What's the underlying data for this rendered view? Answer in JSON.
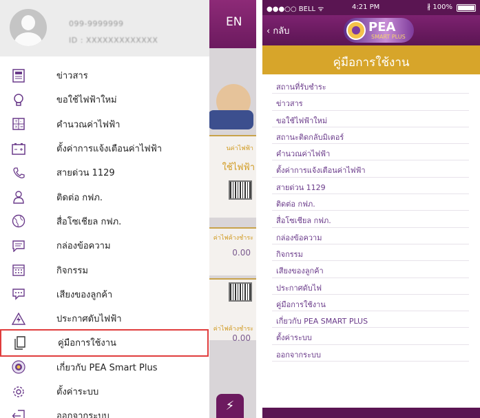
{
  "left": {
    "background_app": {
      "lang_button": "EN",
      "peek_small_1": "นค่าไฟฟ้า",
      "peek_big_1": "ใช้ไฟฟ้า",
      "peek_small_2": "ค่าไฟค้างชำระ",
      "value_1": "0.00",
      "peek_small_3": "ค่าไฟค้างชำระ",
      "value_2": "0.00",
      "bottom_button_icon": "⚡"
    },
    "profile": {
      "phone": "099-9999999",
      "id": "ID : XXXXXXXXXXXXX"
    },
    "menu": [
      {
        "label": "ข่าวสาร",
        "icon": "news-icon"
      },
      {
        "label": "ขอใช้ไฟฟ้าใหม่",
        "icon": "lightbulb-icon"
      },
      {
        "label": "คำนวณค่าไฟฟ้า",
        "icon": "calculator-icon"
      },
      {
        "label": "ตั้งค่าการแจ้งเตือนค่าไฟฟ้า",
        "icon": "battery-alert-icon"
      },
      {
        "label": "สายด่วน 1129",
        "icon": "phone-icon"
      },
      {
        "label": "ติดต่อ กฟภ.",
        "icon": "contact-person-icon"
      },
      {
        "label": "สื่อโซเชียล กฟภ.",
        "icon": "globe-icon"
      },
      {
        "label": "กล่องข้อความ",
        "icon": "message-box-icon"
      },
      {
        "label": "กิจกรรม",
        "icon": "calendar-icon"
      },
      {
        "label": "เสียงของลูกค้า",
        "icon": "chat-icon"
      },
      {
        "label": "ประกาศดับไฟฟ้า",
        "icon": "warning-icon"
      },
      {
        "label": "คู่มือการใช้งาน",
        "icon": "document-icon"
      },
      {
        "label": "เกี่ยวกับ PEA Smart Plus",
        "icon": "pea-logo-icon"
      },
      {
        "label": "ตั้งค่าระบบ",
        "icon": "gear-icon"
      },
      {
        "label": "ออกจากระบบ",
        "icon": "logout-icon"
      }
    ],
    "highlight_color": "#e03c3c"
  },
  "right": {
    "status_bar": {
      "carrier": "●●●○○ BELL ᯤ",
      "time": "4:21 PM",
      "battery": "∦ 100%"
    },
    "nav": {
      "back_label": "‹ กลับ",
      "logo_word": "PEA",
      "logo_sub": "SMART PLUS"
    },
    "title": "คู่มือการใช้งาน",
    "items": [
      "สถานที่รับชำระ",
      "ข่าวสาร",
      "ขอใช้ไฟฟ้าใหม่",
      "สถานะติดกลับมิเตอร์",
      "คำนวณค่าไฟฟ้า",
      "ตั้งค่าการแจ้งเตือนค่าไฟฟ้า",
      "สายด่วน 1129",
      "ติดต่อ กฟภ.",
      "สื่อโซเชียล กฟภ.",
      "กล่องข้อความ",
      "กิจกรรม",
      "เสียงของลูกค้า",
      "ประกาศดับไฟ",
      "คู่มือการใช้งาน",
      "เกี่ยวกับ PEA SMART PLUS",
      "ตั้งค่าระบบ",
      "ออกจากระบบ"
    ],
    "colors": {
      "brand_purple": "#5b1553",
      "title_gold": "#d7a52a",
      "item_text": "#6a3a8a"
    }
  }
}
